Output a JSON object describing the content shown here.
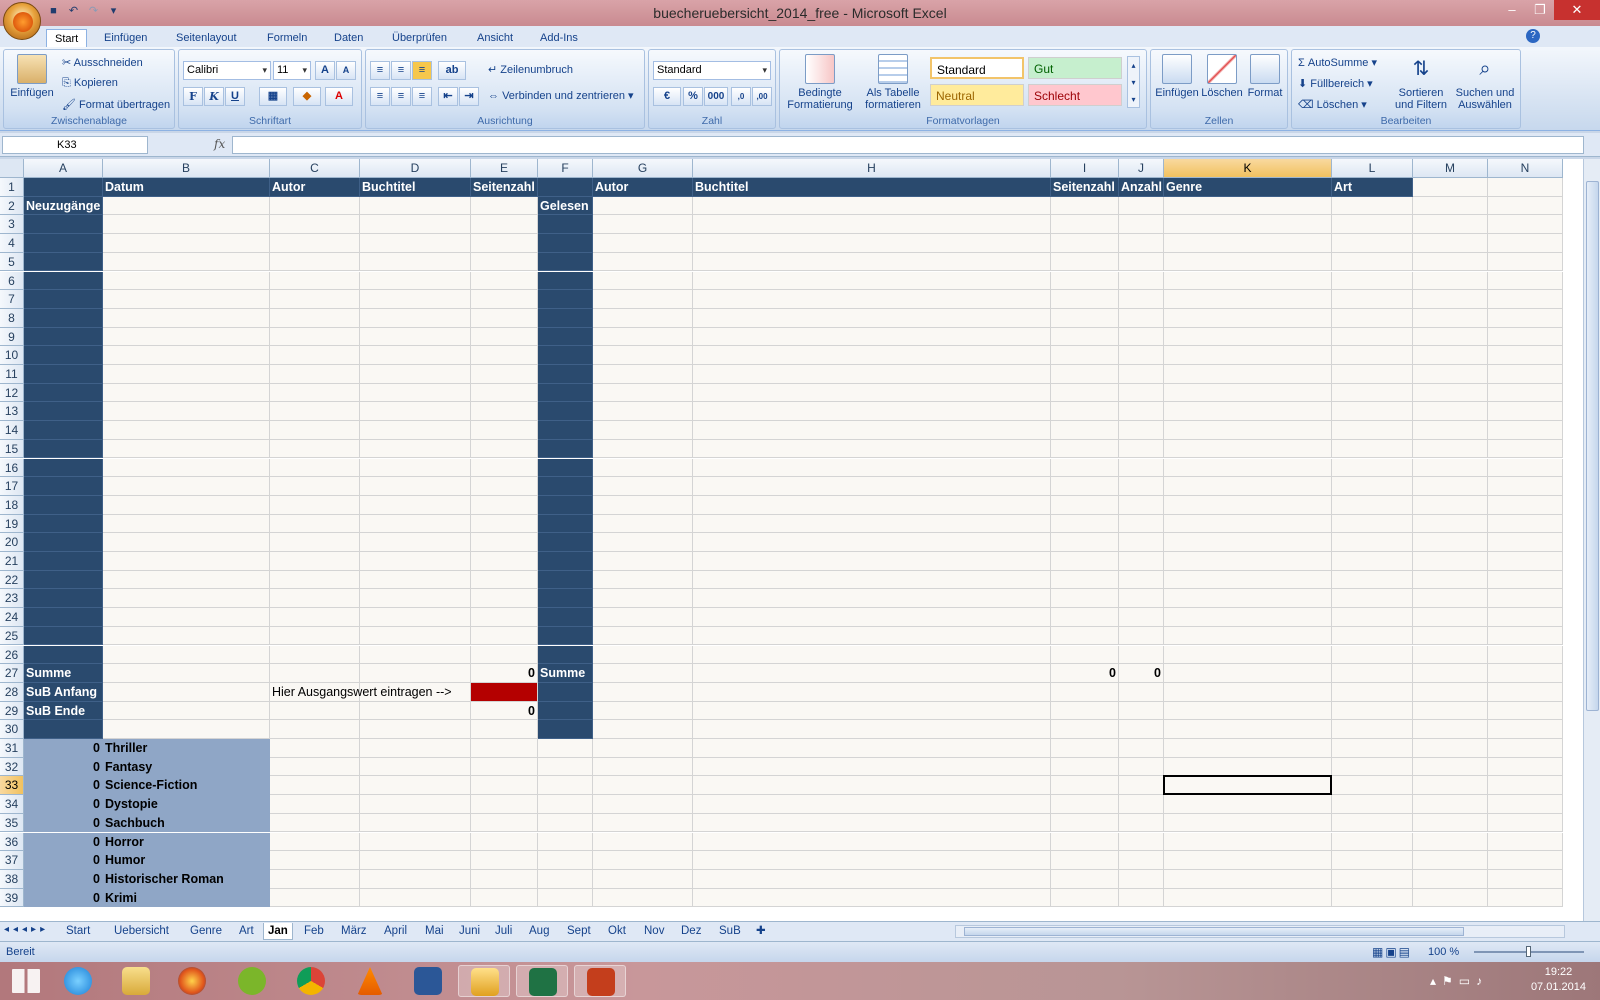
{
  "window": {
    "title": "buecheruebersicht_2014_free - Microsoft Excel"
  },
  "ribbon_tabs": [
    "Start",
    "Einfügen",
    "Seitenlayout",
    "Formeln",
    "Daten",
    "Überprüfen",
    "Ansicht",
    "Add-Ins"
  ],
  "clipboard": {
    "paste": "Einfügen",
    "cut": "Ausschneiden",
    "copy": "Kopieren",
    "format_painter": "Format übertragen",
    "label": "Zwischenablage"
  },
  "font": {
    "name": "Calibri",
    "size": "11",
    "bold": "F",
    "italic": "K",
    "underline": "U",
    "label": "Schriftart"
  },
  "alignment": {
    "wrap": "Zeilenumbruch",
    "merge": "Verbinden und zentrieren",
    "label": "Ausrichtung"
  },
  "number": {
    "format": "Standard",
    "percent": "%",
    "thousands": "000",
    "label": "Zahl"
  },
  "styles": {
    "conditional": "Bedingte Formatierung",
    "as_table": "Als Tabelle formatieren",
    "standard": "Standard",
    "good": "Gut",
    "neutral": "Neutral",
    "bad": "Schlecht",
    "label": "Formatvorlagen"
  },
  "cells_group": {
    "insert": "Einfügen",
    "delete": "Löschen",
    "format": "Format",
    "label": "Zellen"
  },
  "editing": {
    "autosum": "AutoSumme",
    "fill": "Füllbereich",
    "clear": "Löschen",
    "sort": "Sortieren und Filtern",
    "find": "Suchen und Auswählen",
    "label": "Bearbeiten"
  },
  "formula_bar": {
    "name_box": "K33",
    "fx": "fx",
    "formula": ""
  },
  "columns": [
    "A",
    "B",
    "C",
    "D",
    "E",
    "F",
    "G",
    "H",
    "I",
    "J",
    "K",
    "L",
    "M",
    "N"
  ],
  "selected_column": "K",
  "selected_row": "33",
  "rows": [
    "1",
    "2",
    "3",
    "4",
    "5",
    "6",
    "7",
    "8",
    "9",
    "10",
    "11",
    "12",
    "13",
    "14",
    "15",
    "16",
    "17",
    "18",
    "19",
    "20",
    "21",
    "22",
    "23",
    "24",
    "25",
    "26",
    "27",
    "28",
    "29",
    "30",
    "31",
    "32",
    "33",
    "34",
    "35",
    "36",
    "37",
    "38",
    "39"
  ],
  "headers_left": {
    "datum": "Datum",
    "autor": "Autor",
    "buchtitel": "Buchtitel",
    "seitenzahl": "Seitenzahl"
  },
  "headers_right": {
    "autor": "Autor",
    "buchtitel": "Buchtitel",
    "seitenzahl": "Seitenzahl",
    "anzahl": "Anzahl",
    "genre": "Genre",
    "art": "Art"
  },
  "labels": {
    "neuzugaenge": "Neuzugänge",
    "gelesen": "Gelesen",
    "summe_left": "Summe",
    "summe_right": "Summe",
    "sub_anfang": "SuB Anfang",
    "sub_ende": "SuB Ende",
    "hint": "Hier Ausgangswert eintragen -->"
  },
  "values": {
    "summe_seitenzahl": "0",
    "sub_ende": "0",
    "summe_i": "0",
    "summe_j": "0"
  },
  "genres": [
    {
      "count": "0",
      "name": "Thriller"
    },
    {
      "count": "0",
      "name": "Fantasy"
    },
    {
      "count": "0",
      "name": "Science-Fiction"
    },
    {
      "count": "0",
      "name": "Dystopie"
    },
    {
      "count": "0",
      "name": "Sachbuch"
    },
    {
      "count": "0",
      "name": "Horror"
    },
    {
      "count": "0",
      "name": "Humor"
    },
    {
      "count": "0",
      "name": "Historischer Roman"
    },
    {
      "count": "0",
      "name": "Krimi"
    }
  ],
  "sheet_tabs": [
    "Start",
    "Uebersicht",
    "Genre",
    "Art",
    "Jan",
    "Feb",
    "März",
    "April",
    "Mai",
    "Juni",
    "Juli",
    "Aug",
    "Sept",
    "Okt",
    "Nov",
    "Dez",
    "SuB"
  ],
  "active_sheet": "Jan",
  "status": {
    "ready": "Bereit",
    "zoom": "100 %"
  },
  "clock": {
    "time": "19:22",
    "date": "07.01.2014"
  },
  "colors": {
    "navy": "#2a4a6e",
    "greyblue": "#8fa6c6",
    "red": "#b40000",
    "selected_header": "#f1c15f"
  }
}
